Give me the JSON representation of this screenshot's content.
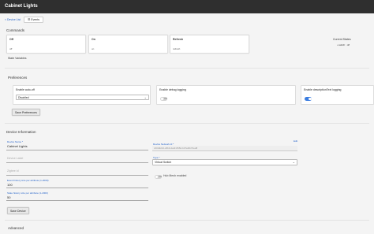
{
  "header": {
    "title": "Cabinet Lights"
  },
  "nav": {
    "back_label": "< Device List",
    "events_label": "Events"
  },
  "commands": {
    "title": "Commands",
    "items": [
      {
        "label": "Off",
        "sub": "off"
      },
      {
        "label": "On",
        "sub": "on"
      },
      {
        "label": "Refresh",
        "sub": "refresh"
      }
    ]
  },
  "current_states": {
    "title": "Current States",
    "items": [
      "switch : off"
    ]
  },
  "state_variables": {
    "title": "State Variables"
  },
  "preferences": {
    "title": "Preferences",
    "auto_off": {
      "label": "Enable auto-off",
      "value": "Disabled"
    },
    "debug": {
      "label": "Enable debug logging",
      "on": false
    },
    "text_logging": {
      "label": "Enable descriptionText logging",
      "on": true
    },
    "save_label": "Save Preferences"
  },
  "device_info": {
    "title": "Device Information",
    "device_name_label": "Device Name *",
    "device_name_value": "Cabinet Lights",
    "device_label_placeholder": "Device Label",
    "zigbee_id_placeholder": "Zigbee Id",
    "event_history_label": "Event history size per attribute (1-2000)",
    "event_history_value": "100",
    "state_history_label": "State history size per attribute (1-2000)",
    "state_history_value": "50",
    "network_id_label": "Device Network Id *",
    "network_id_value": "c00d9c02-c8b9-4a4f-8682-b07af4b70ed8",
    "edit_label": "Edit",
    "type_label": "Type *",
    "type_value": "Virtual Switch",
    "hub_mesh_label": "Hub Mesh enabled",
    "save_label": "Save Device"
  },
  "advanced": {
    "title": "Advanced"
  },
  "colors": {
    "accent": "#3b7de0",
    "topbar": "#2f2f2f"
  }
}
